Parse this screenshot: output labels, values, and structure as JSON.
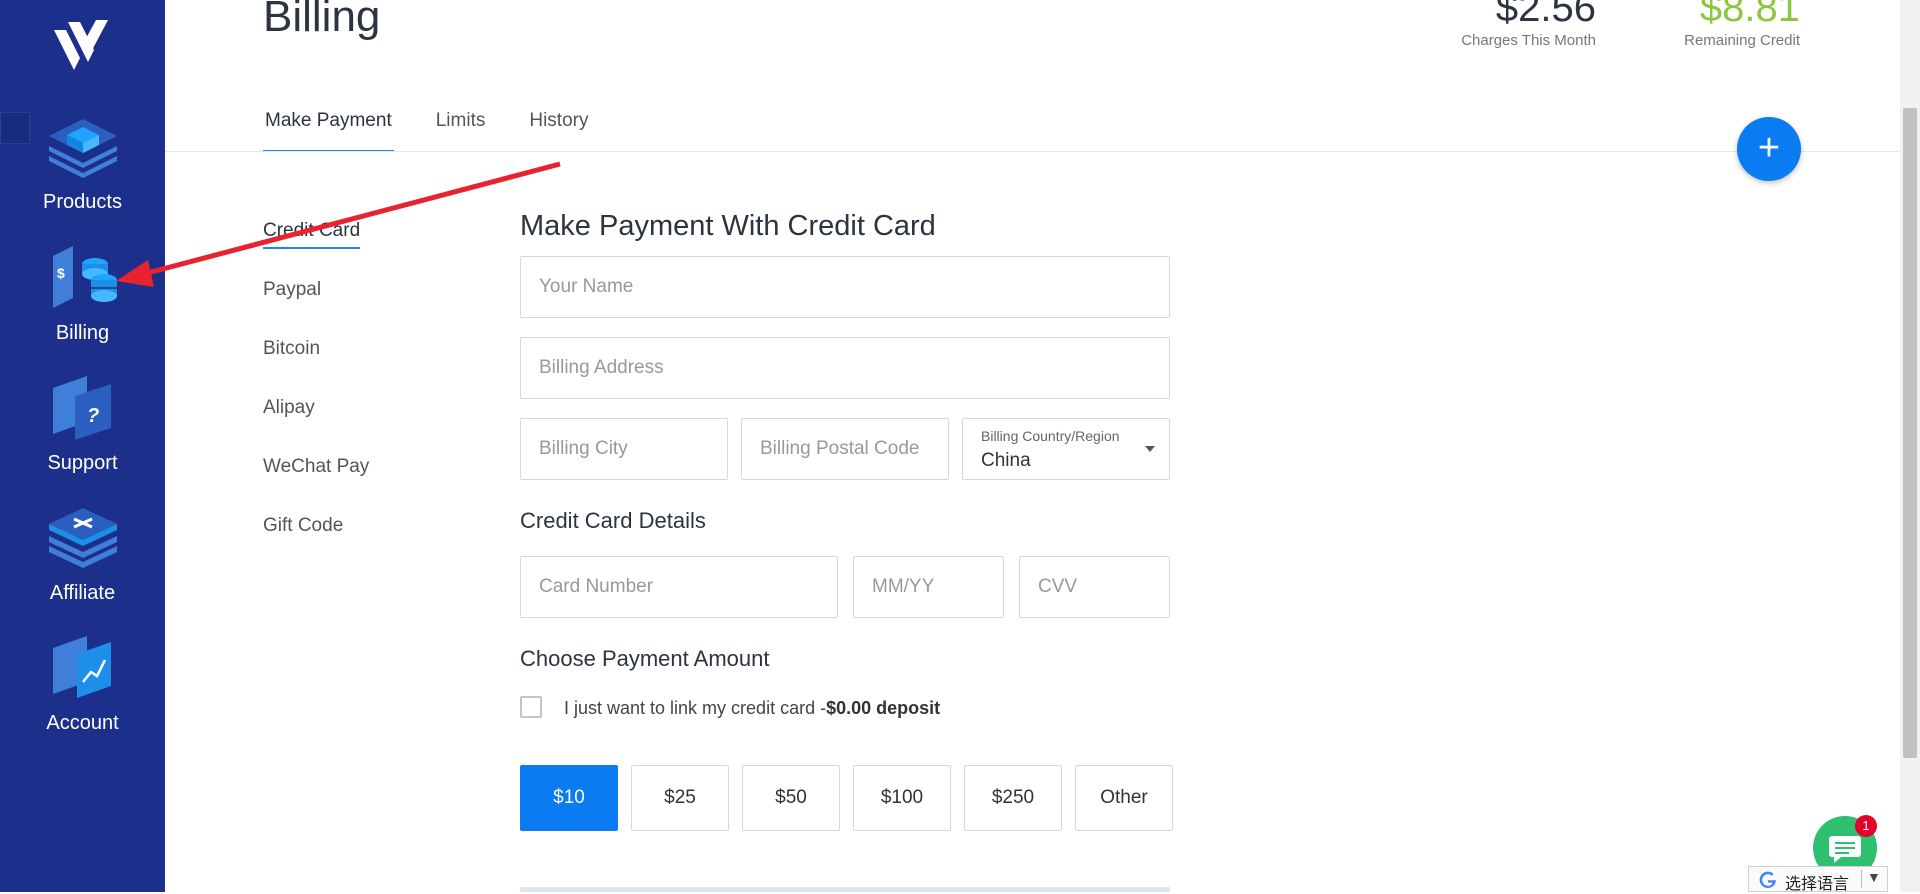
{
  "sidebar": {
    "items": [
      {
        "label": "Products",
        "icon": "products-icon"
      },
      {
        "label": "Billing",
        "icon": "billing-icon"
      },
      {
        "label": "Support",
        "icon": "support-icon"
      },
      {
        "label": "Affiliate",
        "icon": "affiliate-icon"
      },
      {
        "label": "Account",
        "icon": "account-icon"
      }
    ]
  },
  "header": {
    "title": "Billing",
    "charges_value": "$2.56",
    "charges_label": "Charges This Month",
    "credit_value": "$8.81",
    "credit_label": "Remaining Credit"
  },
  "tabs": [
    {
      "label": "Make Payment",
      "active": true
    },
    {
      "label": "Limits"
    },
    {
      "label": "History"
    }
  ],
  "methods": [
    {
      "label": "Credit Card",
      "active": true
    },
    {
      "label": "Paypal"
    },
    {
      "label": "Bitcoin"
    },
    {
      "label": "Alipay"
    },
    {
      "label": "WeChat Pay"
    },
    {
      "label": "Gift Code"
    }
  ],
  "form": {
    "title": "Make Payment With Credit Card",
    "name_placeholder": "Your Name",
    "address_placeholder": "Billing Address",
    "city_placeholder": "Billing City",
    "postal_placeholder": "Billing Postal Code",
    "country_label": "Billing Country/Region",
    "country_value": "China",
    "card_section": "Credit Card Details",
    "card_number_placeholder": "Card Number",
    "expiry_placeholder": "MM/YY",
    "cvv_placeholder": "CVV",
    "amount_section": "Choose Payment Amount",
    "link_text": "I just want to link my credit card -",
    "link_bold": "$0.00 deposit",
    "amounts": [
      "$10",
      "$25",
      "$50",
      "$100",
      "$250",
      "Other"
    ]
  },
  "fab_symbol": "+",
  "chat": {
    "badge": "1"
  },
  "translate": {
    "label": "选择语言",
    "caret": "▼"
  },
  "colors": {
    "sidebar": "#1c2f8a",
    "accent": "#0a7bf0",
    "credit": "#8dc63f",
    "annotation": "#e8232e"
  }
}
